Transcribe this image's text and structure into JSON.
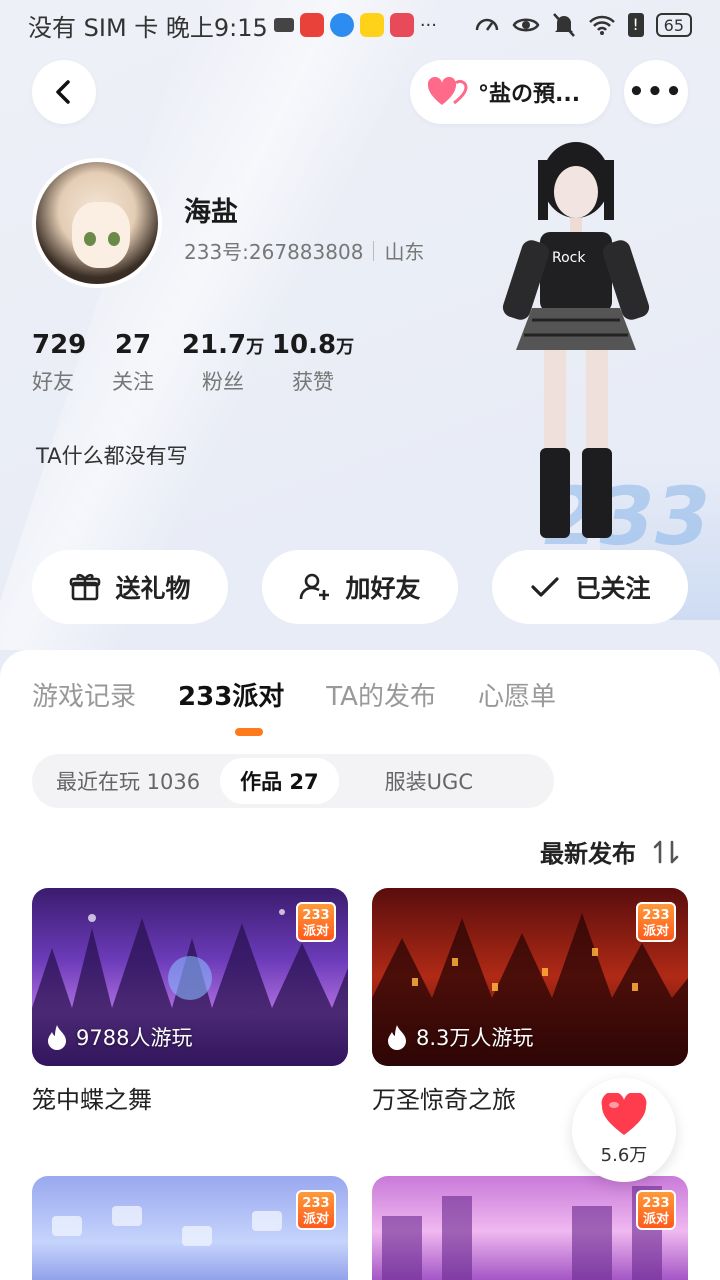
{
  "status_bar": {
    "left_text": "没有 SIM 卡 晚上9:15",
    "battery": "65"
  },
  "header": {
    "cp_label": "°盐の預...",
    "more_icon": "more-dots-icon",
    "back_icon": "chevron-left-icon"
  },
  "profile": {
    "nickname": "海盐",
    "user_id": "233号:267883808",
    "location": "山东",
    "bio": "TA什么都没有写",
    "stats": [
      {
        "num": "729",
        "unit": "",
        "label": "好友"
      },
      {
        "num": "27",
        "unit": "",
        "label": "关注"
      },
      {
        "num": "21.7",
        "unit": "万",
        "label": "粉丝"
      },
      {
        "num": "10.8",
        "unit": "万",
        "label": "获赞"
      }
    ]
  },
  "actions": {
    "gift": "送礼物",
    "add_friend": "加好友",
    "followed": "已关注"
  },
  "tabs": [
    "游戏记录",
    "233派对",
    "TA的发布",
    "心愿单"
  ],
  "active_tab": 1,
  "subtabs": [
    "最近在玩 1036",
    "作品 27",
    "服装UGC"
  ],
  "active_subtab": 1,
  "sort": {
    "label": "最新发布"
  },
  "badge_text": {
    "line1": "233",
    "line2": "派对"
  },
  "cards": [
    {
      "title": "笼中蝶之舞",
      "plays": "9788人游玩"
    },
    {
      "title": "万圣惊奇之旅",
      "plays": "8.3万人游玩"
    },
    {
      "title": "",
      "plays": ""
    },
    {
      "title": "",
      "plays": ""
    }
  ],
  "like_float": {
    "count": "5.6万"
  },
  "colors": {
    "accent": "#ff7a1a",
    "like": "#ff3b4e",
    "heart_pink": "#ff5a7a"
  }
}
